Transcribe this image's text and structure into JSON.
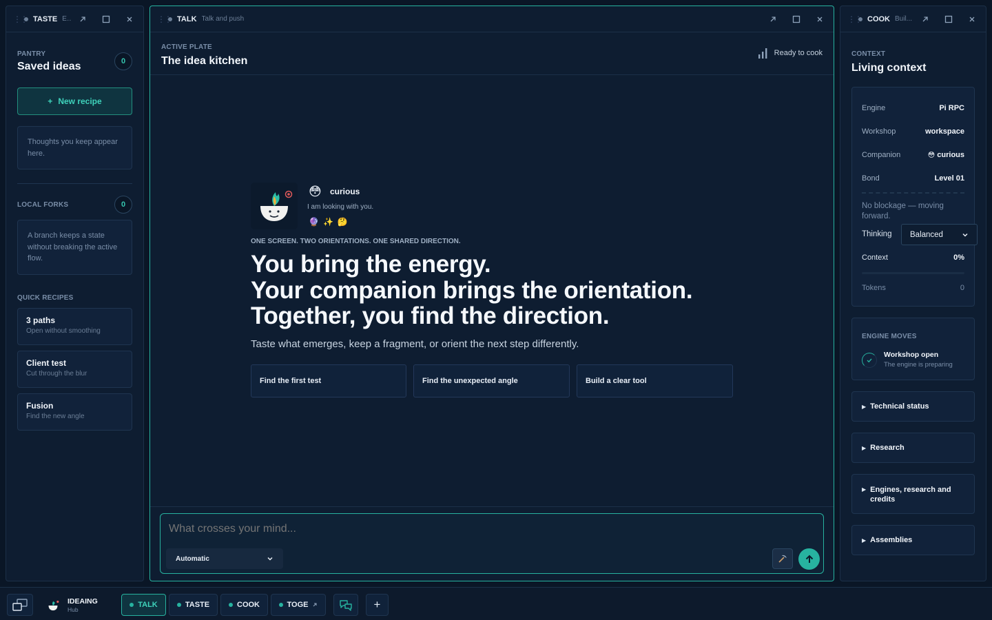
{
  "panels": {
    "taste": {
      "name": "TASTE",
      "sub": "E..."
    },
    "talk": {
      "name": "TALK",
      "sub": "Talk and push"
    },
    "cook": {
      "name": "COOK",
      "sub": "Buil..."
    }
  },
  "pantry": {
    "label": "PANTRY",
    "title": "Saved ideas",
    "count": "0",
    "new_button": "New recipe",
    "new_button_icon": "+",
    "empty_hint": "Thoughts you keep appear here."
  },
  "forks": {
    "label": "LOCAL FORKS",
    "count": "0",
    "hint": "A branch keeps a state without breaking the active flow."
  },
  "quick": {
    "label": "QUICK RECIPES",
    "items": [
      {
        "title": "3 paths",
        "sub": "Open without smoothing"
      },
      {
        "title": "Client test",
        "sub": "Cut through the blur"
      },
      {
        "title": "Fusion",
        "sub": "Find the new angle"
      }
    ]
  },
  "plate": {
    "label": "ACTIVE PLATE",
    "title": "The idea kitchen",
    "status": "Ready to cook"
  },
  "companion": {
    "mood_emoji": "😳",
    "mood": "curious",
    "line": "I am looking with you.",
    "badges": [
      "🔮",
      "✨",
      "🤔"
    ]
  },
  "hero": {
    "eyebrow": "ONE SCREEN. TWO ORIENTATIONS. ONE SHARED DIRECTION.",
    "line1": "You bring the energy.",
    "line2": "Your companion brings the orientation.",
    "line3": "Together, you find the direction.",
    "subtitle": "Taste what emerges, keep a fragment, or orient the next step differently."
  },
  "suggestions": [
    "Find the first test",
    "Find the unexpected angle",
    "Build a clear tool"
  ],
  "composer": {
    "placeholder": "What crosses your mind...",
    "mode": "Automatic",
    "mode_options": [
      "Automatic"
    ]
  },
  "context": {
    "label": "CONTEXT",
    "title": "Living context",
    "engine_k": "Engine",
    "engine_v": "Pi RPC",
    "workshop_k": "Workshop",
    "workshop_v": "workspace",
    "companion_k": "Companion",
    "companion_emoji": "😳",
    "companion_v": "curious",
    "bond_k": "Bond",
    "bond_v": "Level 01",
    "blockage": "No blockage — moving forward.",
    "thinking_k": "Thinking",
    "thinking_v": "Balanced",
    "context_k": "Context",
    "context_v": "0%",
    "context_fill": 0,
    "tokens_k": "Tokens",
    "tokens_v": "0"
  },
  "engine_moves": {
    "label": "ENGINE MOVES",
    "title": "Workshop open",
    "sub": "The engine is preparing"
  },
  "sections": [
    "Technical status",
    "Research",
    "Engines, research and credits",
    "Assemblies"
  ],
  "bottom": {
    "brand": "IDEAING",
    "brand_sub": "Hub",
    "tabs": [
      "TALK",
      "TASTE",
      "COOK",
      "TOGE"
    ],
    "plus": "+"
  },
  "colors": {
    "accent": "#27b3a0",
    "bg": "#0a1626",
    "panel": "#0e1d31"
  }
}
